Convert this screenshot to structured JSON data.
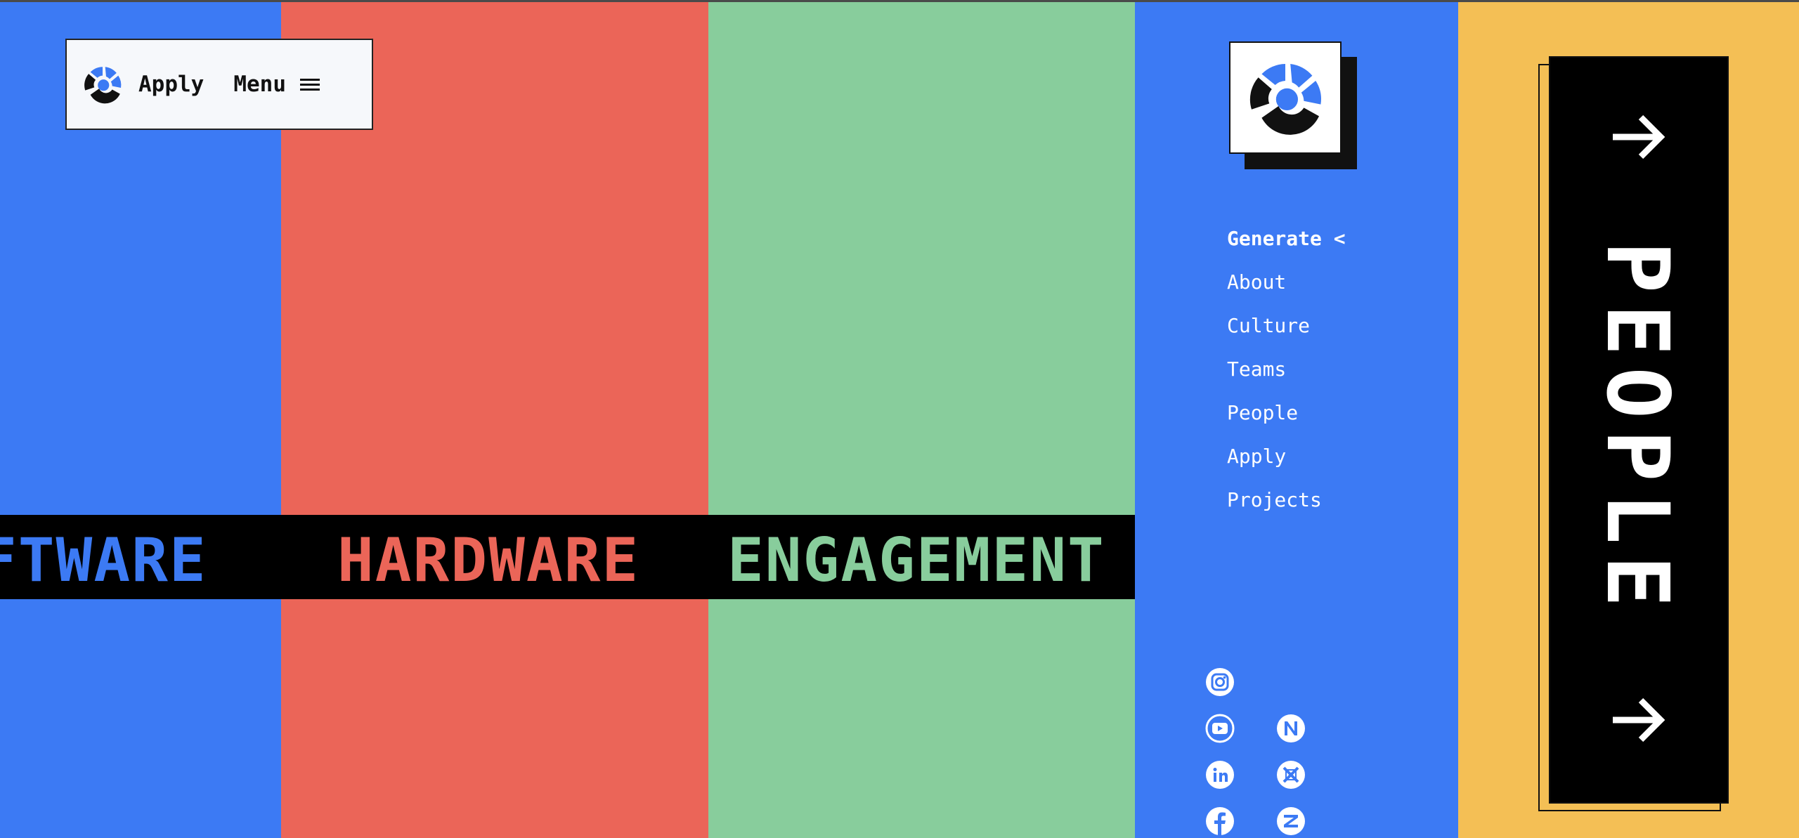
{
  "topbar": {
    "apply_label": "Apply",
    "menu_label": "Menu"
  },
  "ticker": {
    "items": [
      "FTWARE",
      "HARDWARE",
      "ENGAGEMENT"
    ]
  },
  "nav": {
    "items": [
      {
        "label": "Generate <"
      },
      {
        "label": "About"
      },
      {
        "label": "Culture"
      },
      {
        "label": "Teams"
      },
      {
        "label": "People"
      },
      {
        "label": "Apply"
      },
      {
        "label": "Projects"
      }
    ]
  },
  "social": [
    "instagram-icon",
    "youtube-icon",
    "linkedin-icon",
    "facebook-icon",
    "n-icon",
    "x-icon",
    "z-icon"
  ],
  "people_card": {
    "label": "PEOPLE"
  },
  "colors": {
    "blue": "#3c7af4",
    "red": "#eb6558",
    "green": "#88cd9c",
    "yellow": "#f4bf55",
    "black": "#000000"
  }
}
